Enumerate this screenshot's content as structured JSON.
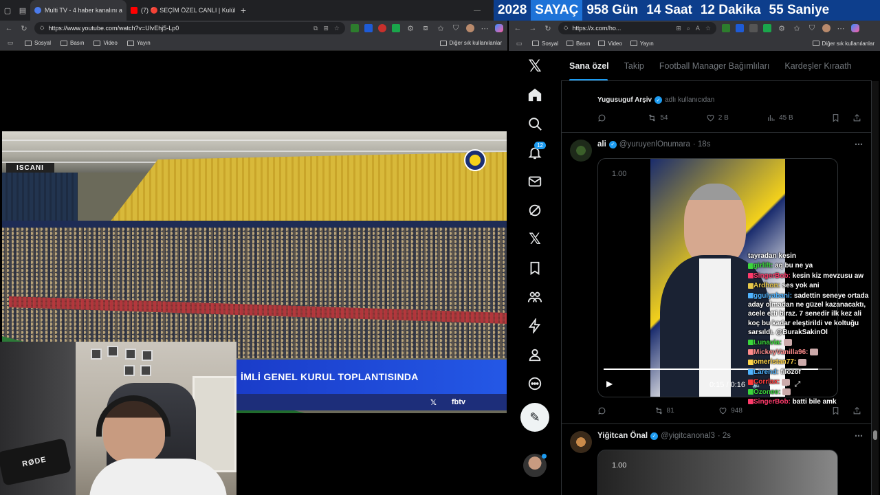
{
  "left_browser": {
    "tabs": [
      {
        "label": "Multi TV - 4 haber kanalını a",
        "active": true
      },
      {
        "label": "(7) 🔴 SEÇİM ÖZEL CANLI | Kulüb",
        "active": false
      }
    ],
    "url": "https://www.youtube.com/watch?v=UlvEhj5-Lp0",
    "bookmarks": [
      "Sosyal",
      "Basın",
      "Video",
      "Yayın"
    ],
    "other_bookmarks": "Diğer sık kullanılanlar"
  },
  "video": {
    "stadium_sign": "ISCANI",
    "banner_text": "İMLİ GENEL KURUL TOPLANTISINDA",
    "banner_x": "𝕏",
    "banner_brand": "fbtv"
  },
  "webcam": {
    "mic_brand": "RØDE"
  },
  "sayac": {
    "year": "2028",
    "label": "SAYAÇ",
    "days": "958 Gün",
    "hours": "14 Saat",
    "minutes": "12 Dakika",
    "seconds": "55 Saniye"
  },
  "right_browser": {
    "url": "https://x.com/ho...",
    "bookmarks": [
      "Sosyal",
      "Basın",
      "Video",
      "Yayın"
    ],
    "other_bookmarks": "Diğer sık kullanılanlar"
  },
  "x": {
    "notifications_count": "12",
    "tabs": [
      "Sana özel",
      "Takip",
      "Football Manager Bağımlıları",
      "Kardeşler Kıraath"
    ],
    "posts": [
      {
        "retweeter_name": "Yugusuguf Arşiv",
        "retweeter_suffix": "adlı kullanıcıdan",
        "replies": "",
        "reposts": "54",
        "likes": "2 B",
        "views": "45 B"
      },
      {
        "name": "ali",
        "handle": "@yuruyenlOnumara",
        "time": "· 18s",
        "speed": "1.00",
        "video_time": "0:15 / 0:16",
        "replies": "",
        "reposts": "81",
        "likes": "948",
        "views": ""
      },
      {
        "name": "Yiğitcan Önal",
        "handle": "@yigitcanonal3",
        "time": "· 2s",
        "speed": "1.00"
      }
    ]
  },
  "chat": [
    {
      "user": "",
      "text": "tayradan kesin",
      "color": "#ffffff"
    },
    {
      "user": "girlift:",
      "text": "aq bu ne ya",
      "color": "#3bd63b"
    },
    {
      "user": "SingerBob:",
      "text": "kesin kiz mevzusu aw",
      "color": "#ff3b6b"
    },
    {
      "user": "Ardhon:",
      "text": "ses yok ani",
      "color": "#e8c84a"
    },
    {
      "user": "ggulyabani:",
      "text": "sadettin seneye ortada aday olmadan ne güzel kazanacaktı, acele etti biraz. 7 senedir ilk kez ali koç bu kadar eleştirildi ve koltuğu sarsıldı. @BurakSakinOl",
      "color": "#4fb3ff"
    },
    {
      "user": "Lunavia:",
      "text": "",
      "color": "#3bd63b"
    },
    {
      "user": "MickeyVanilla96:",
      "text": "",
      "color": "#ff8c8c"
    },
    {
      "user": "omeristan77:",
      "text": "",
      "color": "#ffd54a"
    },
    {
      "user": "Larend:",
      "text": "filozof",
      "color": "#4fb3ff"
    },
    {
      "user": "Corrlax:",
      "text": "",
      "color": "#ff3b3b"
    },
    {
      "user": "Ozonee:",
      "text": "",
      "color": "#3bd63b"
    },
    {
      "user": "SingerBob:",
      "text": "batti bile amk",
      "color": "#ff3b6b"
    }
  ]
}
